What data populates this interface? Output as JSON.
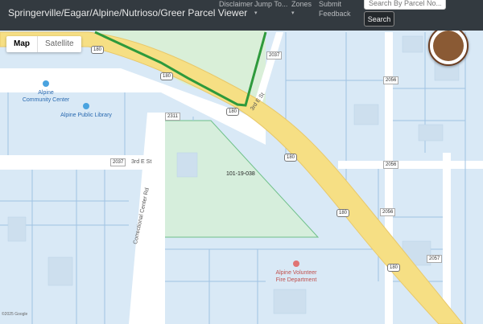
{
  "header": {
    "title": "Springerville/Eagar/Alpine/Nutrioso/Greer Parcel Viewer",
    "nav": {
      "disclaimer": "Disclaimer",
      "jump_to": "Jump To...",
      "zones": "Zones",
      "submit_feedback_1": "Submit",
      "submit_feedback_2": "Feedback"
    },
    "search": {
      "placeholder": "Search By Parcel No...",
      "button": "Search"
    }
  },
  "map": {
    "map_type": {
      "map": "Map",
      "satellite": "Satellite"
    },
    "parcel_id": "101-19-038",
    "pois": {
      "community_center_1": "Alpine",
      "community_center_2": "Community Center",
      "library": "Alpine Public Library",
      "fire_1": "Alpine Volunteer",
      "fire_2": "Fire Department"
    },
    "roads": {
      "third_e_st_a": "3rd E St",
      "third_e_st_b": "3rd E St",
      "correctional": "Correctional Center Rd"
    },
    "shields": {
      "s1": "180",
      "s2": "180",
      "s3": "180",
      "s4": "180",
      "s5": "180",
      "s6": "180"
    },
    "street_numbers": {
      "n2037a": "2037",
      "n2037b": "2037",
      "n2311": "2311",
      "n2056a": "2056",
      "n2056b": "2056",
      "n2056c": "2056",
      "n2057": "2057"
    },
    "watermark": "©2025 Google"
  }
}
